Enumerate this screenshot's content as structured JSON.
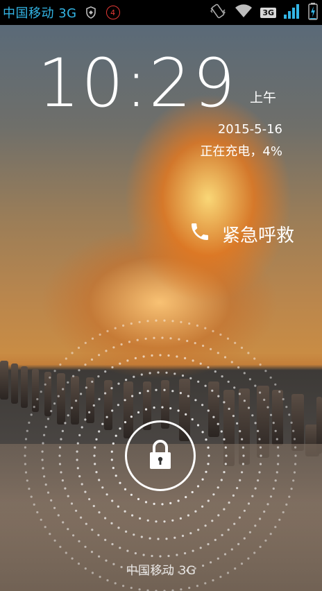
{
  "status_bar": {
    "carrier": "中国移动 3G",
    "notification_count": "4",
    "network_badge": "3G",
    "accent_color": "#33b5e5",
    "icons": [
      "shield-icon",
      "notification-count-badge",
      "vibrate-icon",
      "wifi-icon",
      "network-3g-icon",
      "signal-icon",
      "battery-charging-icon"
    ]
  },
  "lockscreen": {
    "time": "10:29",
    "ampm": "上午",
    "date": "2015-5-16",
    "charging_status": "正在充电，4%",
    "emergency_label": "紧急呼救",
    "carrier_bottom": "中国移动 3G",
    "battery_level_percent": 4
  }
}
